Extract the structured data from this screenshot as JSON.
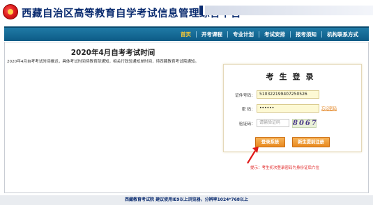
{
  "header": {
    "title": "西藏自治区高等教育自学考试信息管理综合平台",
    "logo_icon": "emblem-icon"
  },
  "nav": {
    "items": [
      {
        "label": "首页",
        "active": true
      },
      {
        "label": "开考课程",
        "active": false
      },
      {
        "label": "专业计划",
        "active": false
      },
      {
        "label": "考试安排",
        "active": false
      },
      {
        "label": "报考须知",
        "active": false
      },
      {
        "label": "机构联系方式",
        "active": false
      }
    ]
  },
  "notice": {
    "title": "2020年4月自考考试时间",
    "body": "2020年4月自考考试时间推迟，具体考试时间待教育部通知，相关行政验通知单时间，待西藏教育考试院通知。"
  },
  "login": {
    "title": "考生登录",
    "id_label": "证件号码：",
    "id_value": "510322199407250526",
    "password_label": "密 码：",
    "password_value": "••••••",
    "forgot_link": "忘记密码",
    "captcha_label": "验证码：",
    "captcha_placeholder": "请输验证码",
    "captcha_text": "8067",
    "login_button": "登录系统",
    "register_button": "新生提前注册"
  },
  "hint": "提示：考生初次登录密码为身份证后六位",
  "footer": "西藏教育考试院    建议使用IE9以上浏览器，分辨率1024*768以上",
  "colors": {
    "nav_bg": "#0d5b86",
    "nav_active": "#ffcc33",
    "title": "#0b2c70",
    "button": "#e8891f",
    "hint": "#e02020",
    "input_bg": "#fdf9d4"
  }
}
